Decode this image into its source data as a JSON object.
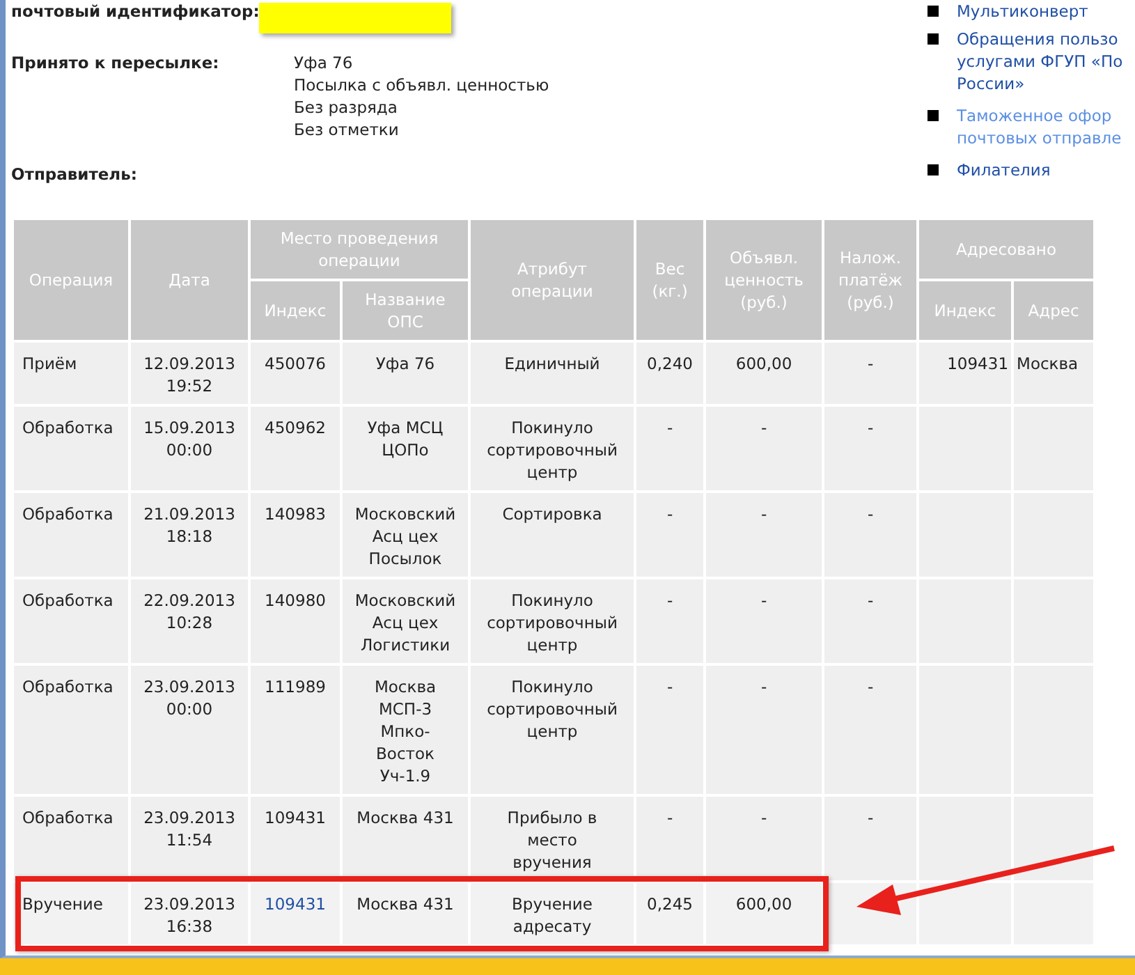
{
  "info": {
    "id_label": "почтовый идентификатор:",
    "accepted_label": "Принято к пересылке:",
    "accepted_values": [
      "Уфа 76",
      "Посылка с объявл. ценностью",
      "Без разряда",
      "Без отметки"
    ],
    "sender_label": "Отправитель:"
  },
  "links": [
    {
      "lines": [
        "Мультиконверт"
      ],
      "color": "#1f4fa6"
    },
    {
      "lines": [
        "Обращения пользо",
        "услугами ФГУП «По",
        "России»"
      ],
      "color": "#1f4fa6"
    },
    {
      "lines": [
        "Таможенное офор",
        "почтовых отправле"
      ],
      "color": "#5b8fe3"
    },
    {
      "lines": [
        "Филателия"
      ],
      "color": "#1f4fa6"
    }
  ],
  "table": {
    "columns": [
      {
        "label": "Операция"
      },
      {
        "label": "Дата"
      },
      {
        "label": "Место проведения\nоперации",
        "colspan": 2,
        "children": [
          "Индекс",
          "Название\nОПС"
        ]
      },
      {
        "label": "Атрибут\nоперации"
      },
      {
        "label": "Вес\n(кг.)"
      },
      {
        "label": "Объявл.\nценность\n(руб.)"
      },
      {
        "label": "Налож.\nплатёж\n(руб.)"
      },
      {
        "label": "Адресовано",
        "colspan": 2,
        "children": [
          "Индекс",
          "Адрес"
        ]
      }
    ],
    "rows": [
      {
        "highlighted": false,
        "index_link": false,
        "cells": [
          "Приём",
          "12.09.2013\n19:52",
          "450076",
          "Уфа 76",
          "Единичный",
          "0,240",
          "600,00",
          "-",
          "109431",
          "Москва"
        ]
      },
      {
        "highlighted": false,
        "index_link": false,
        "cells": [
          "Обработка",
          "15.09.2013\n00:00",
          "450962",
          "Уфа МСЦ\nЦОПо",
          "Покинуло\nсортировочный\nцентр",
          "-",
          "-",
          "-",
          null,
          null
        ]
      },
      {
        "highlighted": false,
        "index_link": false,
        "cells": [
          "Обработка",
          "21.09.2013\n18:18",
          "140983",
          "Московский\nАсц цех\nПосылок",
          "Сортировка",
          "-",
          "-",
          "-",
          null,
          null
        ]
      },
      {
        "highlighted": false,
        "index_link": false,
        "cells": [
          "Обработка",
          "22.09.2013\n10:28",
          "140980",
          "Московский\nАсц цех\nЛогистики",
          "Покинуло\nсортировочный\nцентр",
          "-",
          "-",
          "-",
          null,
          null
        ]
      },
      {
        "highlighted": false,
        "index_link": false,
        "cells": [
          "Обработка",
          "23.09.2013\n00:00",
          "111989",
          "Москва\nМСП-3\nМпко-\nВосток\nУч-1.9",
          "Покинуло\nсортировочный\nцентр",
          "-",
          "-",
          "-",
          null,
          null
        ]
      },
      {
        "highlighted": false,
        "index_link": false,
        "cells": [
          "Обработка",
          "23.09.2013\n11:54",
          "109431",
          "Москва 431",
          "Прибыло в\nместо\nвручения",
          "-",
          "-",
          "-",
          null,
          null
        ]
      },
      {
        "highlighted": true,
        "index_link": true,
        "cells": [
          "Вручение",
          "23.09.2013\n16:38",
          "109431",
          "Москва 431",
          "Вручение\nадресату",
          "0,245",
          "600,00",
          null,
          null,
          null
        ]
      }
    ]
  }
}
